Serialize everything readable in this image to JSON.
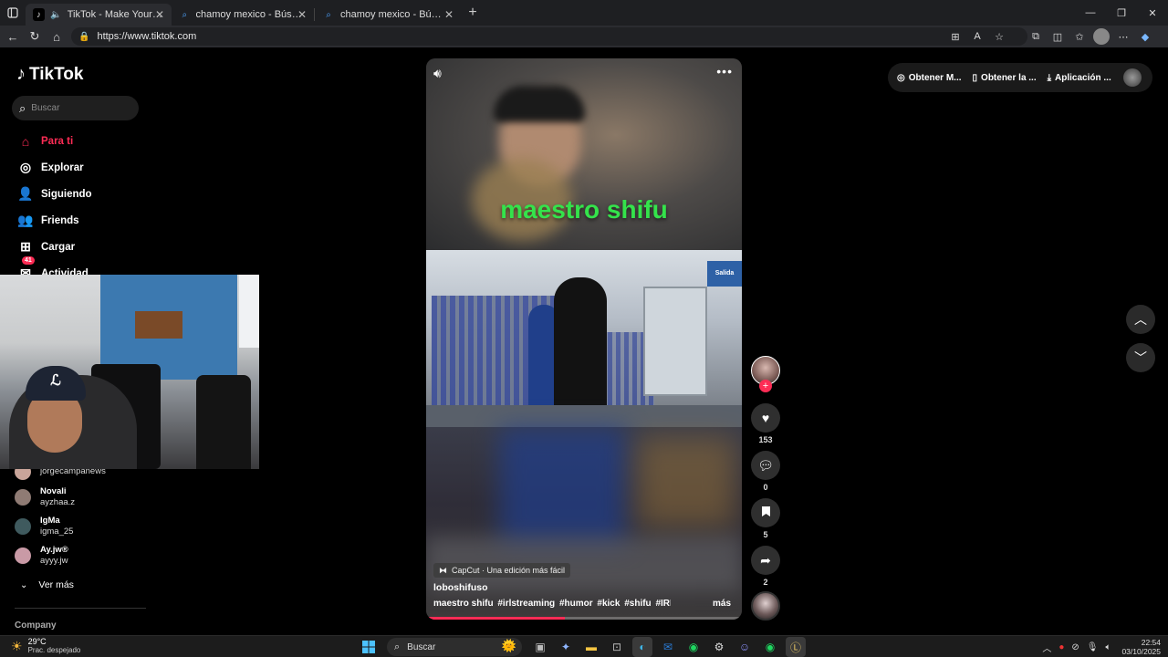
{
  "browser": {
    "tabs": [
      {
        "title": "TikTok - Make Your Day",
        "icon": "tiktok-icon",
        "active": true
      },
      {
        "title": "chamoy mexico - Búsqueda",
        "icon": "search-icon",
        "active": false
      },
      {
        "title": "chamoy mexico - Búsqueda Imágenes",
        "icon": "search-icon",
        "active": false
      }
    ],
    "url": "https://www.tiktok.com"
  },
  "tiktok": {
    "logo_text": "TikTok",
    "search_placeholder": "Buscar",
    "nav": [
      {
        "label": "Para ti",
        "icon": "home-icon",
        "active": true
      },
      {
        "label": "Explorar",
        "icon": "compass-icon"
      },
      {
        "label": "Siguiendo",
        "icon": "following-icon"
      },
      {
        "label": "Friends",
        "icon": "friends-icon"
      },
      {
        "label": "Cargar",
        "icon": "upload-icon"
      },
      {
        "label": "Actividad",
        "icon": "activity-icon",
        "badge": "41"
      }
    ],
    "following": [
      {
        "name": "",
        "handle": "jorgecampanews",
        "color": "#c9a59a"
      },
      {
        "name": "Novali",
        "handle": "ayzhaa.z",
        "color": "#8f7b74"
      },
      {
        "name": "IgMa",
        "handle": "igma_25",
        "color": "#3f5a5e"
      },
      {
        "name": "Ay.jw®",
        "handle": "ayyy.jw",
        "color": "#c99aa6"
      }
    ],
    "ver_mas": "Ver más",
    "company": "Company",
    "header": {
      "items": [
        {
          "label": "Obtener M...",
          "icon": "coin-icon"
        },
        {
          "label": "Obtener la ...",
          "icon": "phone-icon"
        },
        {
          "label": "Aplicación ...",
          "icon": "download-icon"
        }
      ]
    },
    "video": {
      "caption": "maestro shifu",
      "sign_text": "Salida",
      "capcut_label": "CapCut · Una edición más fácil",
      "username": "loboshifuso",
      "description": "maestro shifu",
      "hashtags": [
        "#irlstreaming",
        "#humor",
        "#kick",
        "#shifu",
        "#IRL",
        "..."
      ],
      "more_label": "más",
      "progress": 0.44,
      "likes": "153",
      "comments": "0",
      "saves": "5",
      "shares": "2"
    }
  },
  "taskbar": {
    "temp": "29°C",
    "condition": "Prac. despejado",
    "search_label": "Buscar",
    "time": "22:54",
    "date": "03/10/2025"
  }
}
